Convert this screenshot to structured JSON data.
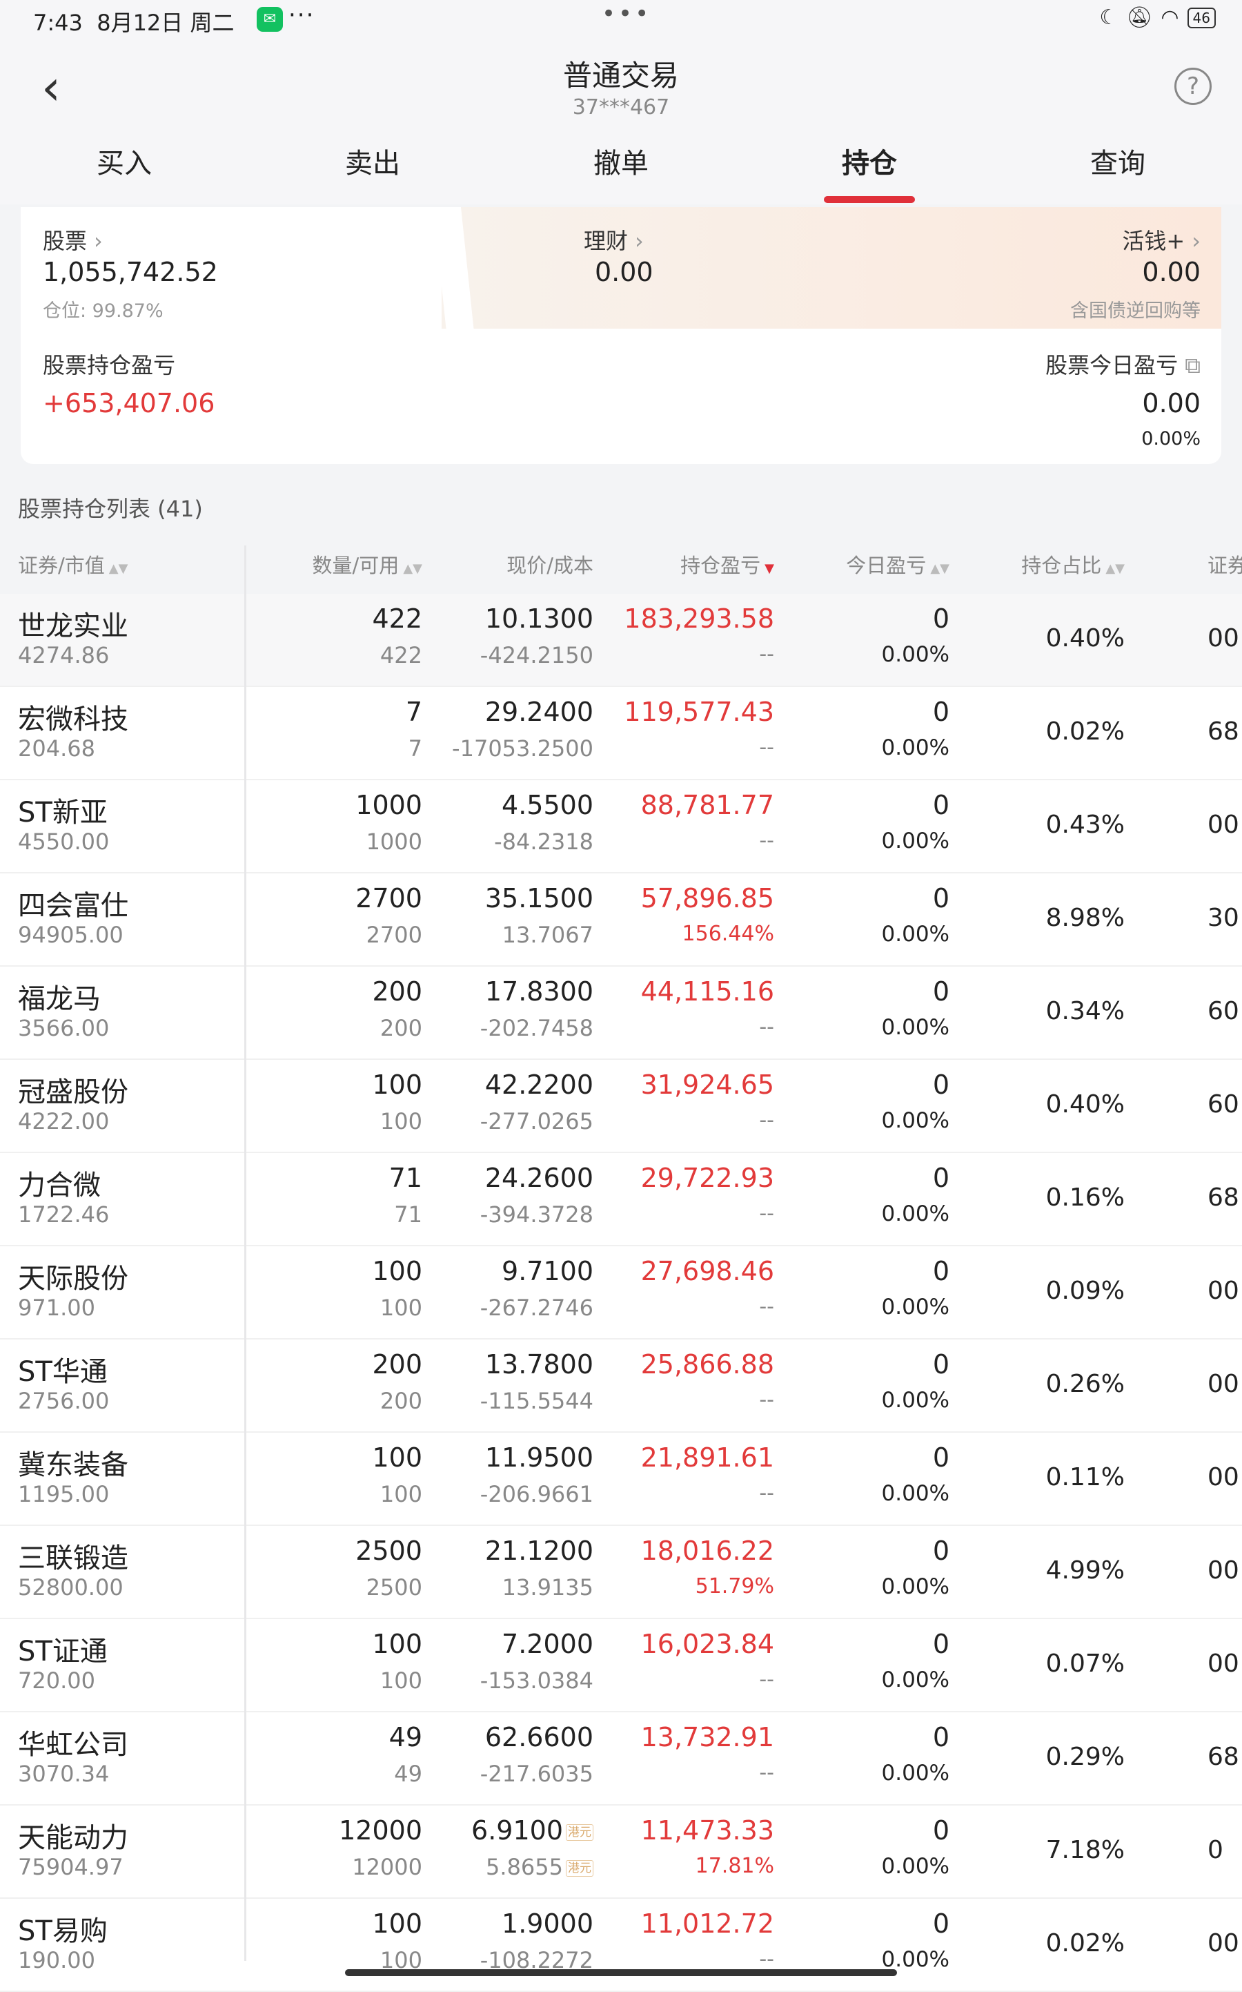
{
  "status_bar": {
    "time": "7:43",
    "date": "8月12日 周二",
    "more_dots": "···",
    "center_dots": "•••",
    "battery": "46"
  },
  "header": {
    "title": "普通交易",
    "account": "37***467",
    "back_icon": "chevron-left-icon",
    "help_icon": "question-circle-icon"
  },
  "tabs": [
    "买入",
    "卖出",
    "撤单",
    "持仓",
    "查询"
  ],
  "active_tab": "持仓",
  "account": {
    "stock_label": "股票",
    "stock_value": "1,055,742.52",
    "position_ratio": "仓位: 99.87%",
    "wealth_label": "理财",
    "wealth_value": "0.00",
    "cash_label": "活钱+",
    "cash_value": "0.00",
    "cash_note": "含国债逆回购等",
    "holding_pnl_label": "股票持仓盈亏",
    "holding_pnl_value": "+653,407.06",
    "today_pnl_label": "股票今日盈亏",
    "today_pnl_value": "0.00",
    "today_pnl_pct": "0.00%"
  },
  "list_title": "股票持仓列表 (41)",
  "columns": {
    "name": "证券/市值",
    "qty": "数量/可用",
    "price": "现价/成本",
    "pnl": "持仓盈亏",
    "today": "今日盈亏",
    "ratio": "持仓占比",
    "code": "证券"
  },
  "rows": [
    {
      "name": "世龙实业",
      "mv": "4274.86",
      "qty": "422",
      "avail": "422",
      "price": "10.1300",
      "cost": "-424.2150",
      "pnl": "183,293.58",
      "pnl_pct": "--",
      "today": "0",
      "today_pct": "0.00%",
      "ratio": "0.40%",
      "code": "00"
    },
    {
      "name": "宏微科技",
      "mv": "204.68",
      "qty": "7",
      "avail": "7",
      "price": "29.2400",
      "cost": "-17053.2500",
      "pnl": "119,577.43",
      "pnl_pct": "--",
      "today": "0",
      "today_pct": "0.00%",
      "ratio": "0.02%",
      "code": "68"
    },
    {
      "name": "ST新亚",
      "mv": "4550.00",
      "qty": "1000",
      "avail": "1000",
      "price": "4.5500",
      "cost": "-84.2318",
      "pnl": "88,781.77",
      "pnl_pct": "--",
      "today": "0",
      "today_pct": "0.00%",
      "ratio": "0.43%",
      "code": "00"
    },
    {
      "name": "四会富仕",
      "mv": "94905.00",
      "qty": "2700",
      "avail": "2700",
      "price": "35.1500",
      "cost": "13.7067",
      "pnl": "57,896.85",
      "pnl_pct": "156.44%",
      "today": "0",
      "today_pct": "0.00%",
      "ratio": "8.98%",
      "code": "30"
    },
    {
      "name": "福龙马",
      "mv": "3566.00",
      "qty": "200",
      "avail": "200",
      "price": "17.8300",
      "cost": "-202.7458",
      "pnl": "44,115.16",
      "pnl_pct": "--",
      "today": "0",
      "today_pct": "0.00%",
      "ratio": "0.34%",
      "code": "60"
    },
    {
      "name": "冠盛股份",
      "mv": "4222.00",
      "qty": "100",
      "avail": "100",
      "price": "42.2200",
      "cost": "-277.0265",
      "pnl": "31,924.65",
      "pnl_pct": "--",
      "today": "0",
      "today_pct": "0.00%",
      "ratio": "0.40%",
      "code": "60"
    },
    {
      "name": "力合微",
      "mv": "1722.46",
      "qty": "71",
      "avail": "71",
      "price": "24.2600",
      "cost": "-394.3728",
      "pnl": "29,722.93",
      "pnl_pct": "--",
      "today": "0",
      "today_pct": "0.00%",
      "ratio": "0.16%",
      "code": "68"
    },
    {
      "name": "天际股份",
      "mv": "971.00",
      "qty": "100",
      "avail": "100",
      "price": "9.7100",
      "cost": "-267.2746",
      "pnl": "27,698.46",
      "pnl_pct": "--",
      "today": "0",
      "today_pct": "0.00%",
      "ratio": "0.09%",
      "code": "00"
    },
    {
      "name": "ST华通",
      "mv": "2756.00",
      "qty": "200",
      "avail": "200",
      "price": "13.7800",
      "cost": "-115.5544",
      "pnl": "25,866.88",
      "pnl_pct": "--",
      "today": "0",
      "today_pct": "0.00%",
      "ratio": "0.26%",
      "code": "00"
    },
    {
      "name": "冀东装备",
      "mv": "1195.00",
      "qty": "100",
      "avail": "100",
      "price": "11.9500",
      "cost": "-206.9661",
      "pnl": "21,891.61",
      "pnl_pct": "--",
      "today": "0",
      "today_pct": "0.00%",
      "ratio": "0.11%",
      "code": "00"
    },
    {
      "name": "三联锻造",
      "mv": "52800.00",
      "qty": "2500",
      "avail": "2500",
      "price": "21.1200",
      "cost": "13.9135",
      "pnl": "18,016.22",
      "pnl_pct": "51.79%",
      "today": "0",
      "today_pct": "0.00%",
      "ratio": "4.99%",
      "code": "00"
    },
    {
      "name": "ST证通",
      "mv": "720.00",
      "qty": "100",
      "avail": "100",
      "price": "7.2000",
      "cost": "-153.0384",
      "pnl": "16,023.84",
      "pnl_pct": "--",
      "today": "0",
      "today_pct": "0.00%",
      "ratio": "0.07%",
      "code": "00"
    },
    {
      "name": "华虹公司",
      "mv": "3070.34",
      "qty": "49",
      "avail": "49",
      "price": "62.6600",
      "cost": "-217.6035",
      "pnl": "13,732.91",
      "pnl_pct": "--",
      "today": "0",
      "today_pct": "0.00%",
      "ratio": "0.29%",
      "code": "68"
    },
    {
      "name": "天能动力",
      "mv": "75904.97",
      "qty": "12000",
      "avail": "12000",
      "price": "6.9100",
      "cost": "5.8655",
      "pnl": "11,473.33",
      "pnl_pct": "17.81%",
      "today": "0",
      "today_pct": "0.00%",
      "ratio": "7.18%",
      "code": "0",
      "currency": "港元"
    },
    {
      "name": "ST易购",
      "mv": "190.00",
      "qty": "100",
      "avail": "100",
      "price": "1.9000",
      "cost": "-108.2272",
      "pnl": "11,012.72",
      "pnl_pct": "--",
      "today": "0",
      "today_pct": "0.00%",
      "ratio": "0.02%",
      "code": "00"
    }
  ]
}
